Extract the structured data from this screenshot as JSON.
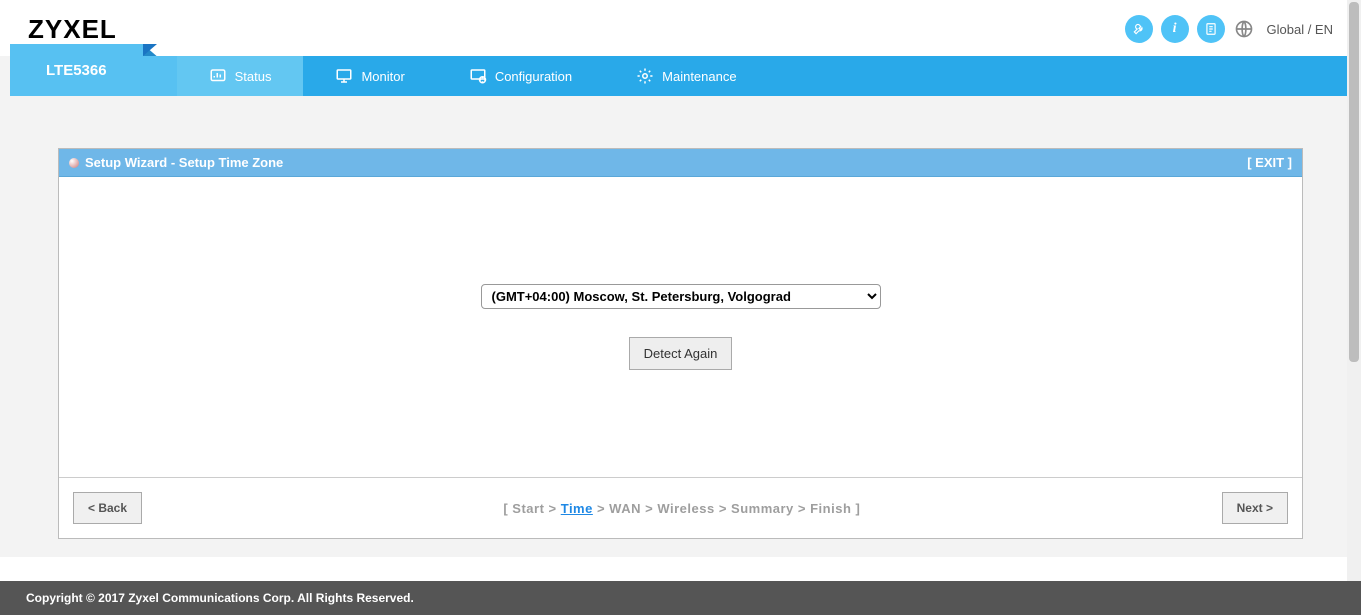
{
  "header": {
    "logo": "ZYXEL",
    "lang_label": "Global / EN"
  },
  "nav": {
    "device_name": "LTE5366",
    "items": [
      {
        "label": "Status"
      },
      {
        "label": "Monitor"
      },
      {
        "label": "Configuration"
      },
      {
        "label": "Maintenance"
      }
    ]
  },
  "panel": {
    "title": "Setup Wizard - Setup Time Zone",
    "exit_label": "[ EXIT ]",
    "timezone_value": "(GMT+04:00) Moscow, St. Petersburg, Volgograd",
    "detect_button": "Detect Again",
    "back_button": "< Back",
    "next_button": "Next >",
    "steps": {
      "prefix": "[ ",
      "suffix": " ]",
      "sep": " > ",
      "list": [
        "Start",
        "Time",
        "WAN",
        "Wireless",
        "Summary",
        "Finish"
      ],
      "active_index": 1
    }
  },
  "footer": {
    "copyright": "Copyright © 2017 Zyxel Communications Corp. All Rights Reserved."
  }
}
